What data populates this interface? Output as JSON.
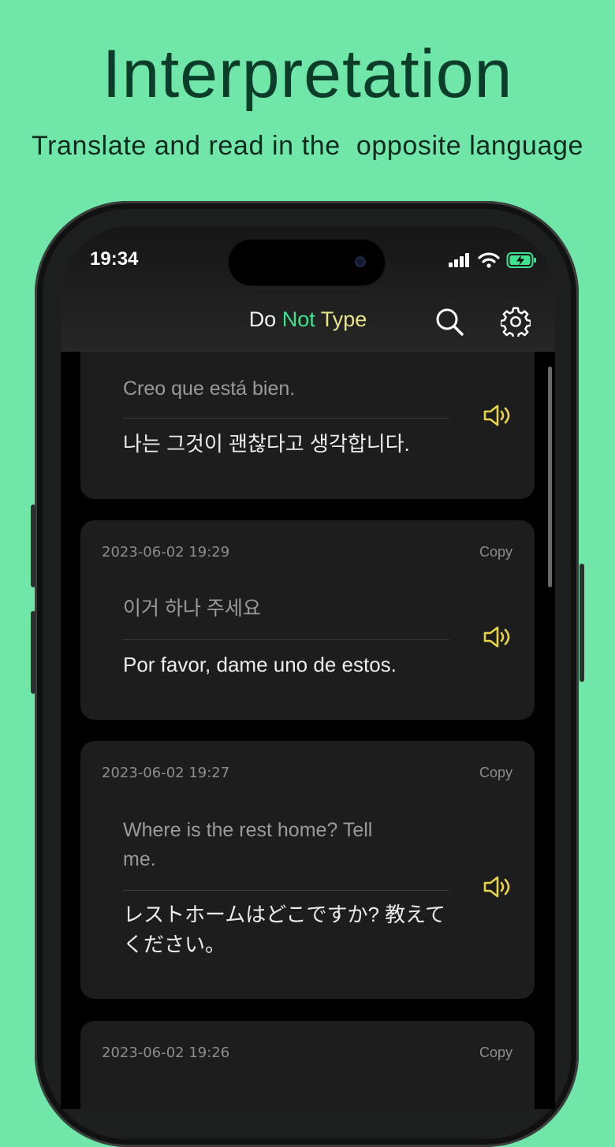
{
  "promo": {
    "headline": "Interpretation",
    "subline": "Translate and read in the  opposite language"
  },
  "status_bar": {
    "time": "19:34"
  },
  "navbar": {
    "title_part1": "Do",
    "title_part2": "Not",
    "title_part3": "Type",
    "search_icon": "search-icon",
    "settings_icon": "gear-icon"
  },
  "colors": {
    "background": "#70e6a9",
    "accent_green": "#3ee38f",
    "accent_yellow": "#e7e586",
    "speaker": "#e7d34a"
  },
  "cards": [
    {
      "timestamp": "",
      "copy_label": "",
      "source": "Creo que está bien.",
      "translation": "나는 그것이 괜찮다고 생각합니다."
    },
    {
      "timestamp": "2023-06-02 19:29",
      "copy_label": "Copy",
      "source": "이거 하나 주세요",
      "translation": "Por favor, dame uno de estos."
    },
    {
      "timestamp": "2023-06-02 19:27",
      "copy_label": "Copy",
      "source": "Where is the rest home? Tell me.",
      "translation": "レストホームはどこですか? 教えてください。"
    },
    {
      "timestamp": "2023-06-02 19:26",
      "copy_label": "Copy",
      "source": "",
      "translation": ""
    }
  ]
}
